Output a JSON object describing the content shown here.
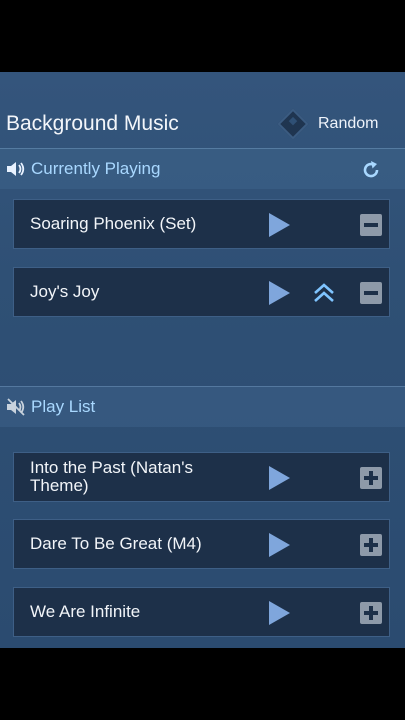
{
  "header": {
    "title": "Background Music",
    "random_label": "Random"
  },
  "currently_playing": {
    "label": "Currently Playing",
    "tracks": [
      {
        "name": "Soaring Phoenix (Set)"
      },
      {
        "name": "Joy's Joy"
      }
    ]
  },
  "play_list": {
    "label": "Play List",
    "tracks": [
      {
        "name": "Into the Past (Natan's Theme)"
      },
      {
        "name": "Dare To Be Great (M4)"
      },
      {
        "name": "We Are Infinite"
      }
    ]
  },
  "colors": {
    "panel_bg": "#2f5075",
    "section_text": "#a9d8ff",
    "play_icon": "#7fa6dc",
    "square_button": "#8e9aa9"
  }
}
